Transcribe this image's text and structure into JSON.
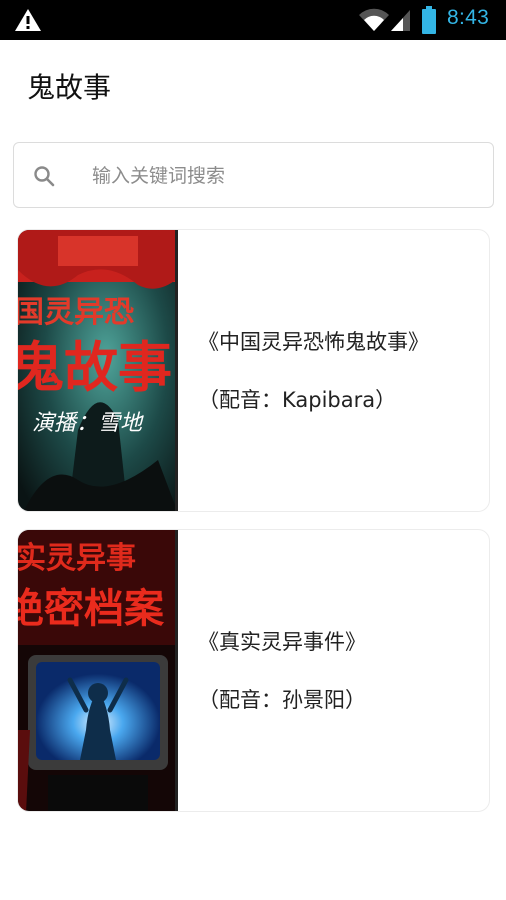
{
  "status_bar": {
    "time": "8:43",
    "icons": [
      "warning-icon",
      "wifi-icon",
      "signal-icon",
      "battery-icon"
    ],
    "accent_color": "#33b5e5"
  },
  "header": {
    "title": "鬼故事"
  },
  "search": {
    "placeholder": "输入关键词搜索",
    "value": ""
  },
  "stories": [
    {
      "title": "《中国灵异恐怖鬼故事》",
      "voice": "（配音：Kapibara）",
      "cover_text": [
        "国灵异恐",
        "鬼故事",
        "演播：雪地"
      ]
    },
    {
      "title": "《真实灵异事件》",
      "voice": "（配音：孙景阳）",
      "cover_text": [
        "实灵异事",
        "绝密档案"
      ]
    }
  ]
}
